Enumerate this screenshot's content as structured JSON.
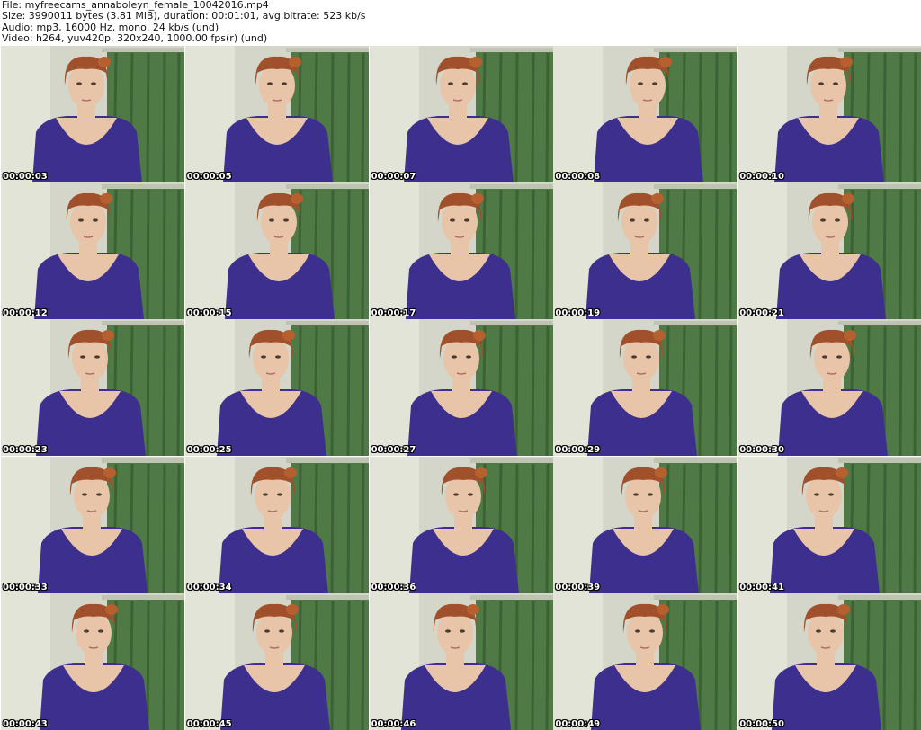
{
  "header": {
    "file": "File: myfreecams_annaboleyn_female_10042016.mp4",
    "size": "Size: 3990011 bytes (3.81 MiB), duration: 00:01:01, avg.bitrate: 523 kb/s",
    "audio": "Audio: mp3, 16000 Hz, mono, 24 kb/s (und)",
    "video": "Video: h264, yuv420p, 320x240, 1000.00 fps(r) (und)"
  },
  "thumbnails": [
    "00:00:03",
    "00:00:05",
    "00:00:07",
    "00:00:08",
    "00:00:10",
    "00:00:12",
    "00:00:15",
    "00:00:17",
    "00:00:19",
    "00:00:21",
    "00:00:23",
    "00:00:25",
    "00:00:27",
    "00:00:29",
    "00:00:30",
    "00:00:33",
    "00:00:34",
    "00:00:36",
    "00:00:39",
    "00:00:41",
    "00:00:43",
    "00:00:45",
    "00:00:46",
    "00:00:49",
    "00:00:50"
  ],
  "colors": {
    "wall": "#d3d6c8",
    "curtain": "#4f7a45",
    "curtain_dark": "#3c6135",
    "hair": "#a0502a",
    "skin": "#e8c4a8",
    "dress": "#3d2f8e"
  }
}
